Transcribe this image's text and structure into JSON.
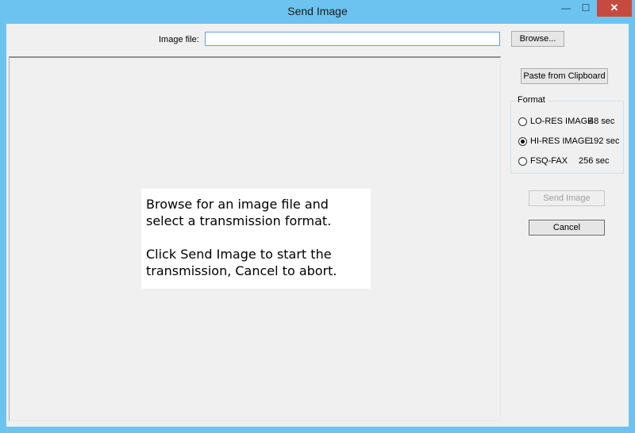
{
  "window": {
    "title": "Send Image",
    "minimize_glyph": "—",
    "maximize_glyph": "☐",
    "close_glyph": "✕"
  },
  "image_file": {
    "label": "Image file:",
    "value": "",
    "placeholder": ""
  },
  "buttons": {
    "browse": "Browse...",
    "paste": "Paste from Clipboard",
    "send": "Send Image",
    "cancel": "Cancel"
  },
  "format": {
    "legend": "Format",
    "options": [
      {
        "name": "LO-RES IMAGE",
        "time": "48 sec",
        "checked": false
      },
      {
        "name": "HI-RES IMAGE",
        "time": "192 sec",
        "checked": true
      },
      {
        "name": "FSQ-FAX",
        "time": "256 sec",
        "checked": false
      }
    ]
  },
  "instructions": {
    "line1": "Browse for an image file and select a transmission format.",
    "line2": "Click Send Image to start the transmission, Cancel to abort."
  }
}
